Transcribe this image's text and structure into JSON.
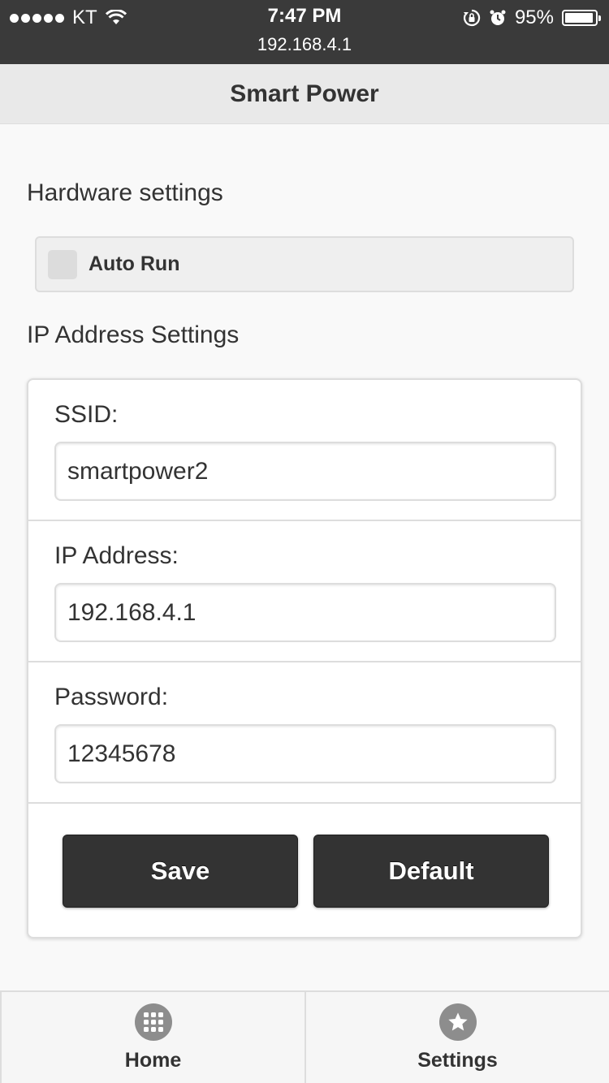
{
  "status_bar": {
    "carrier": "KT",
    "time": "7:47 PM",
    "url": "192.168.4.1",
    "battery": "95%",
    "battery_level": 0.95
  },
  "header": {
    "title": "Smart Power"
  },
  "hardware": {
    "title": "Hardware settings",
    "auto_run_label": "Auto Run"
  },
  "ip_settings": {
    "title": "IP Address Settings",
    "ssid_label": "SSID:",
    "ssid_value": "smartpower2",
    "ip_label": "IP Address:",
    "ip_value": "192.168.4.1",
    "password_label": "Password:",
    "password_value": "12345678",
    "save_label": "Save",
    "default_label": "Default"
  },
  "tabs": [
    {
      "label": "Home",
      "icon": "grid-icon"
    },
    {
      "label": "Settings",
      "icon": "star-icon"
    }
  ]
}
